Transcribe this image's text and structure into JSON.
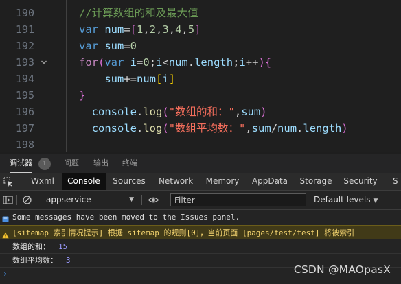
{
  "editor": {
    "line_numbers": [
      "190",
      "191",
      "192",
      "193",
      "194",
      "195",
      "196",
      "197",
      "198"
    ],
    "lines": [
      [
        {
          "t": "//计算数组的和及最大值",
          "c": "tk-comment"
        }
      ],
      [
        {
          "t": "var ",
          "c": "tk-kw"
        },
        {
          "t": "num",
          "c": "tk-var"
        },
        {
          "t": "=",
          "c": "tk-plain"
        },
        {
          "t": "[",
          "c": "tk-br1"
        },
        {
          "t": "1",
          "c": "tk-num"
        },
        {
          "t": ",",
          "c": "tk-plain"
        },
        {
          "t": "2",
          "c": "tk-num"
        },
        {
          "t": ",",
          "c": "tk-plain"
        },
        {
          "t": "3",
          "c": "tk-num"
        },
        {
          "t": ",",
          "c": "tk-plain"
        },
        {
          "t": "4",
          "c": "tk-num"
        },
        {
          "t": ",",
          "c": "tk-plain"
        },
        {
          "t": "5",
          "c": "tk-num"
        },
        {
          "t": "]",
          "c": "tk-br1"
        }
      ],
      [
        {
          "t": "var ",
          "c": "tk-kw"
        },
        {
          "t": "sum",
          "c": "tk-var"
        },
        {
          "t": "=",
          "c": "tk-plain"
        },
        {
          "t": "0",
          "c": "tk-num"
        }
      ],
      [
        {
          "t": "for",
          "c": "tk-ctrl"
        },
        {
          "t": "(",
          "c": "tk-br1"
        },
        {
          "t": "var ",
          "c": "tk-kw"
        },
        {
          "t": "i",
          "c": "tk-var"
        },
        {
          "t": "=",
          "c": "tk-plain"
        },
        {
          "t": "0",
          "c": "tk-num"
        },
        {
          "t": ";",
          "c": "tk-plain"
        },
        {
          "t": "i",
          "c": "tk-var"
        },
        {
          "t": "<",
          "c": "tk-plain"
        },
        {
          "t": "num",
          "c": "tk-var"
        },
        {
          "t": ".",
          "c": "tk-plain"
        },
        {
          "t": "length",
          "c": "tk-prop"
        },
        {
          "t": ";",
          "c": "tk-plain"
        },
        {
          "t": "i",
          "c": "tk-var"
        },
        {
          "t": "++",
          "c": "tk-plain"
        },
        {
          "t": ")",
          "c": "tk-br1"
        },
        {
          "t": "{",
          "c": "tk-br1"
        }
      ],
      [
        {
          "t": "    ",
          "c": "tk-plain"
        },
        {
          "t": "sum",
          "c": "tk-var"
        },
        {
          "t": "+=",
          "c": "tk-plain"
        },
        {
          "t": "num",
          "c": "tk-var"
        },
        {
          "t": "[",
          "c": "tk-br2"
        },
        {
          "t": "i",
          "c": "tk-var"
        },
        {
          "t": "]",
          "c": "tk-br2"
        }
      ],
      [
        {
          "t": "}",
          "c": "tk-br1"
        }
      ],
      [
        {
          "t": "  ",
          "c": "tk-plain"
        },
        {
          "t": "console",
          "c": "tk-var"
        },
        {
          "t": ".",
          "c": "tk-plain"
        },
        {
          "t": "log",
          "c": "tk-fn"
        },
        {
          "t": "(",
          "c": "tk-br1"
        },
        {
          "t": "\"数组的和：\"",
          "c": "tk-str"
        },
        {
          "t": ",",
          "c": "tk-plain"
        },
        {
          "t": "sum",
          "c": "tk-var"
        },
        {
          "t": ")",
          "c": "tk-br1"
        }
      ],
      [
        {
          "t": "  ",
          "c": "tk-plain"
        },
        {
          "t": "console",
          "c": "tk-var"
        },
        {
          "t": ".",
          "c": "tk-plain"
        },
        {
          "t": "log",
          "c": "tk-fn"
        },
        {
          "t": "(",
          "c": "tk-br1"
        },
        {
          "t": "\"数组平均数：\"",
          "c": "tk-str"
        },
        {
          "t": ",",
          "c": "tk-plain"
        },
        {
          "t": "sum",
          "c": "tk-var"
        },
        {
          "t": "/",
          "c": "tk-plain"
        },
        {
          "t": "num",
          "c": "tk-var"
        },
        {
          "t": ".",
          "c": "tk-plain"
        },
        {
          "t": "length",
          "c": "tk-prop"
        },
        {
          "t": ")",
          "c": "tk-br1"
        }
      ],
      []
    ]
  },
  "panel_tabs": {
    "debugger": "调试器",
    "debugger_badge": "1",
    "issues": "问题",
    "output": "输出",
    "terminal": "终端"
  },
  "devtools_tabs": [
    "Wxml",
    "Console",
    "Sources",
    "Network",
    "Memory",
    "AppData",
    "Storage",
    "Security",
    "S"
  ],
  "devtools_active": "Console",
  "toolbar": {
    "context": "appservice",
    "filter_placeholder": "Filter",
    "levels": "Default levels"
  },
  "console": {
    "info": "Some messages have been moved to the Issues panel.",
    "warning": "[sitemap 索引情况提示] 根据 sitemap 的规则[0]，当前页面 [pages/test/test] 将被索引",
    "logs": [
      {
        "label": "数组的和：",
        "value": "15"
      },
      {
        "label": "数组平均数：",
        "value": "3"
      }
    ],
    "prompt": "›"
  },
  "watermark": "CSDN @MAOpasX",
  "colors": {
    "accent": "#4a9eff",
    "warning_bg": "#413a18",
    "warning_text": "#f3d36f",
    "string": "#f26d5b",
    "keyword": "#569cd6"
  }
}
